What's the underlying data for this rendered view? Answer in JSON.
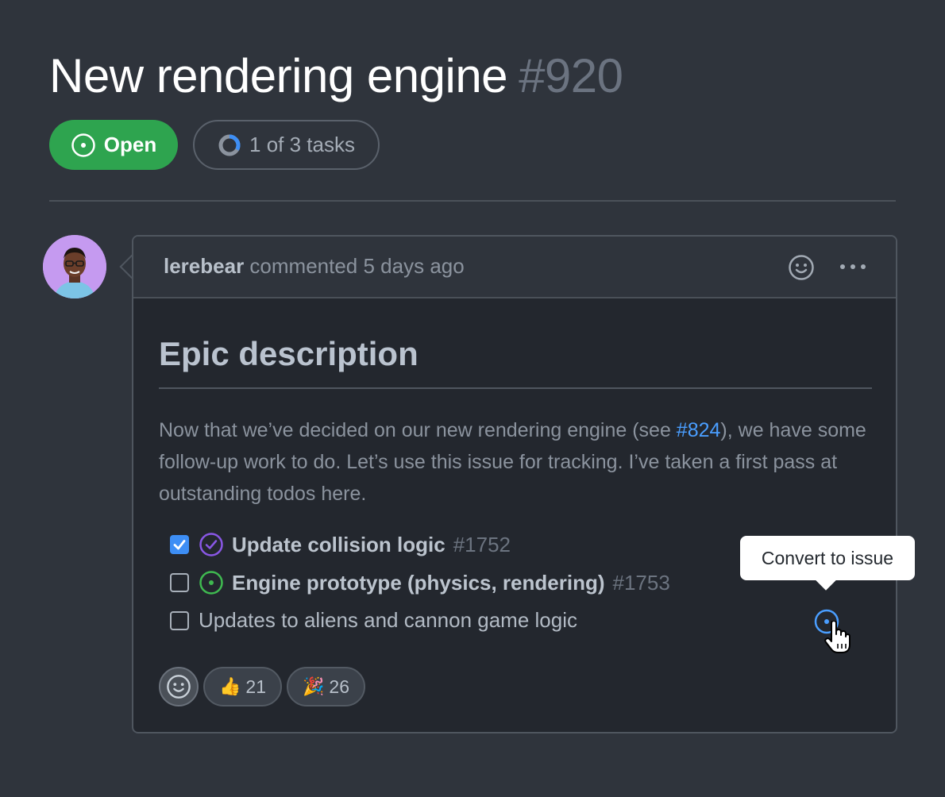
{
  "issue": {
    "title": "New rendering engine",
    "number": "#920",
    "status": "Open",
    "tasks_summary": "1 of 3 tasks",
    "tasks_progress_fraction": 0.33
  },
  "comment": {
    "author": "lerebear",
    "meta": "commented 5 days ago",
    "heading": "Epic description",
    "body_before_link": "Now that we’ve decided on our new rendering engine (see ",
    "body_link": "#824",
    "body_after_link": "), we have some follow-up work to do. Let’s use this issue for tracking. I’ve taken a first pass at outstanding todos here."
  },
  "tasks": [
    {
      "title": "Update collision logic",
      "number": "#1752",
      "checked": true,
      "state": "closed"
    },
    {
      "title": "Engine prototype (physics, rendering)",
      "number": "#1753",
      "checked": false,
      "state": "open"
    },
    {
      "title": "Updates to aliens and cannon game logic",
      "checked": false
    }
  ],
  "tooltip": {
    "text": "Convert to issue"
  },
  "reactions": [
    {
      "emoji": "👍",
      "count": "21"
    },
    {
      "emoji": "🎉",
      "count": "26"
    }
  ],
  "colors": {
    "background": "#2f343c",
    "open_green": "#2ea44f",
    "link_blue": "#4a9eff",
    "closed_purple": "#8957e5",
    "open_icon_green": "#3fb950"
  }
}
